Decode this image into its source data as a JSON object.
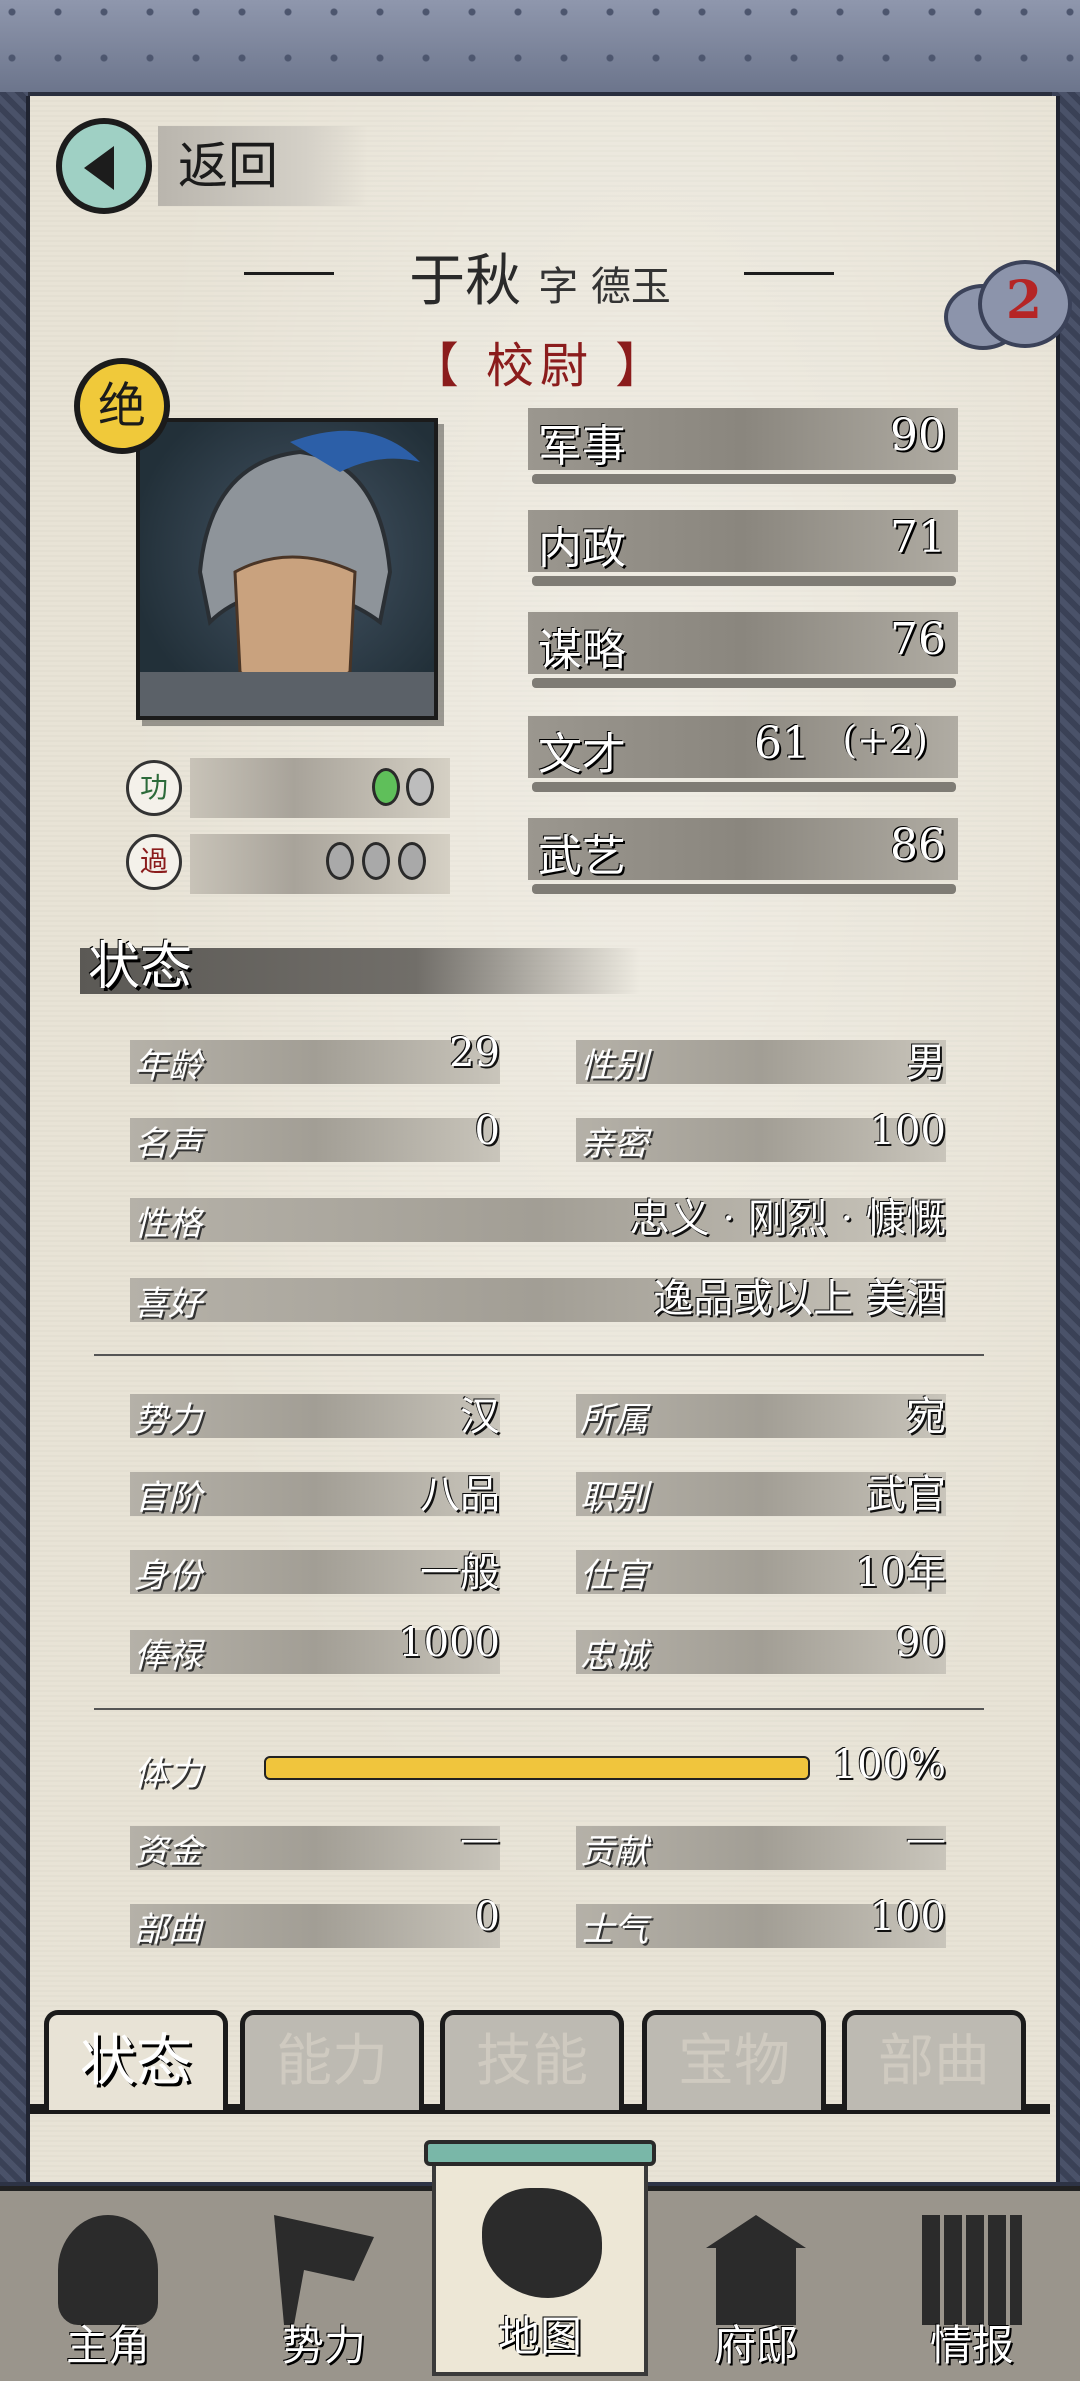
{
  "header": {
    "back_label": "返回"
  },
  "character": {
    "name": "于秋",
    "courtesy_prefix": "字",
    "courtesy_name": "德玉",
    "title": "【 校尉 】",
    "rank_badge": "绝",
    "cloud_count": "2"
  },
  "merit": {
    "merit_icon": "功",
    "merit_tokens": 2,
    "demerit_icon": "過",
    "demerit_tokens": 3
  },
  "stats": [
    {
      "label": "军事",
      "value": "90"
    },
    {
      "label": "内政",
      "value": "71"
    },
    {
      "label": "谋略",
      "value": "76"
    },
    {
      "label": "文才",
      "value": "61",
      "bonus": "(+2)"
    },
    {
      "label": "武艺",
      "value": "86"
    }
  ],
  "section_title": "状态",
  "info": {
    "age": {
      "label": "年龄",
      "value": "29"
    },
    "gender": {
      "label": "性别",
      "value": "男"
    },
    "fame": {
      "label": "名声",
      "value": "0"
    },
    "intimacy": {
      "label": "亲密",
      "value": "100"
    },
    "personality": {
      "label": "性格",
      "value": "忠义 · 刚烈 · 慷慨"
    },
    "hobby": {
      "label": "喜好",
      "value": "逸品或以上 美酒"
    },
    "faction": {
      "label": "势力",
      "value": "汉"
    },
    "belong": {
      "label": "所属",
      "value": "宛"
    },
    "rank": {
      "label": "官阶",
      "value": "八品"
    },
    "job": {
      "label": "职别",
      "value": "武官"
    },
    "status": {
      "label": "身份",
      "value": "一般"
    },
    "service": {
      "label": "仕官",
      "value": "10年"
    },
    "salary": {
      "label": "俸禄",
      "value": "1000"
    },
    "loyalty": {
      "label": "忠诚",
      "value": "90"
    },
    "stamina": {
      "label": "体力",
      "value": "100%",
      "fraction": 1.0
    },
    "funds": {
      "label": "资金",
      "value": "—"
    },
    "contribution": {
      "label": "贡献",
      "value": "—"
    },
    "troops": {
      "label": "部曲",
      "value": "0"
    },
    "morale": {
      "label": "士气",
      "value": "100"
    }
  },
  "tabs": [
    "状态",
    "能力",
    "技能",
    "宝物",
    "部曲"
  ],
  "active_tab": "状态",
  "bottom_nav": [
    "主角",
    "势力",
    "地图",
    "府邸",
    "情报"
  ],
  "colors": {
    "accent": "#f0c53d",
    "title_red": "#8b1c1c",
    "back_button": "#9fd0c4"
  }
}
